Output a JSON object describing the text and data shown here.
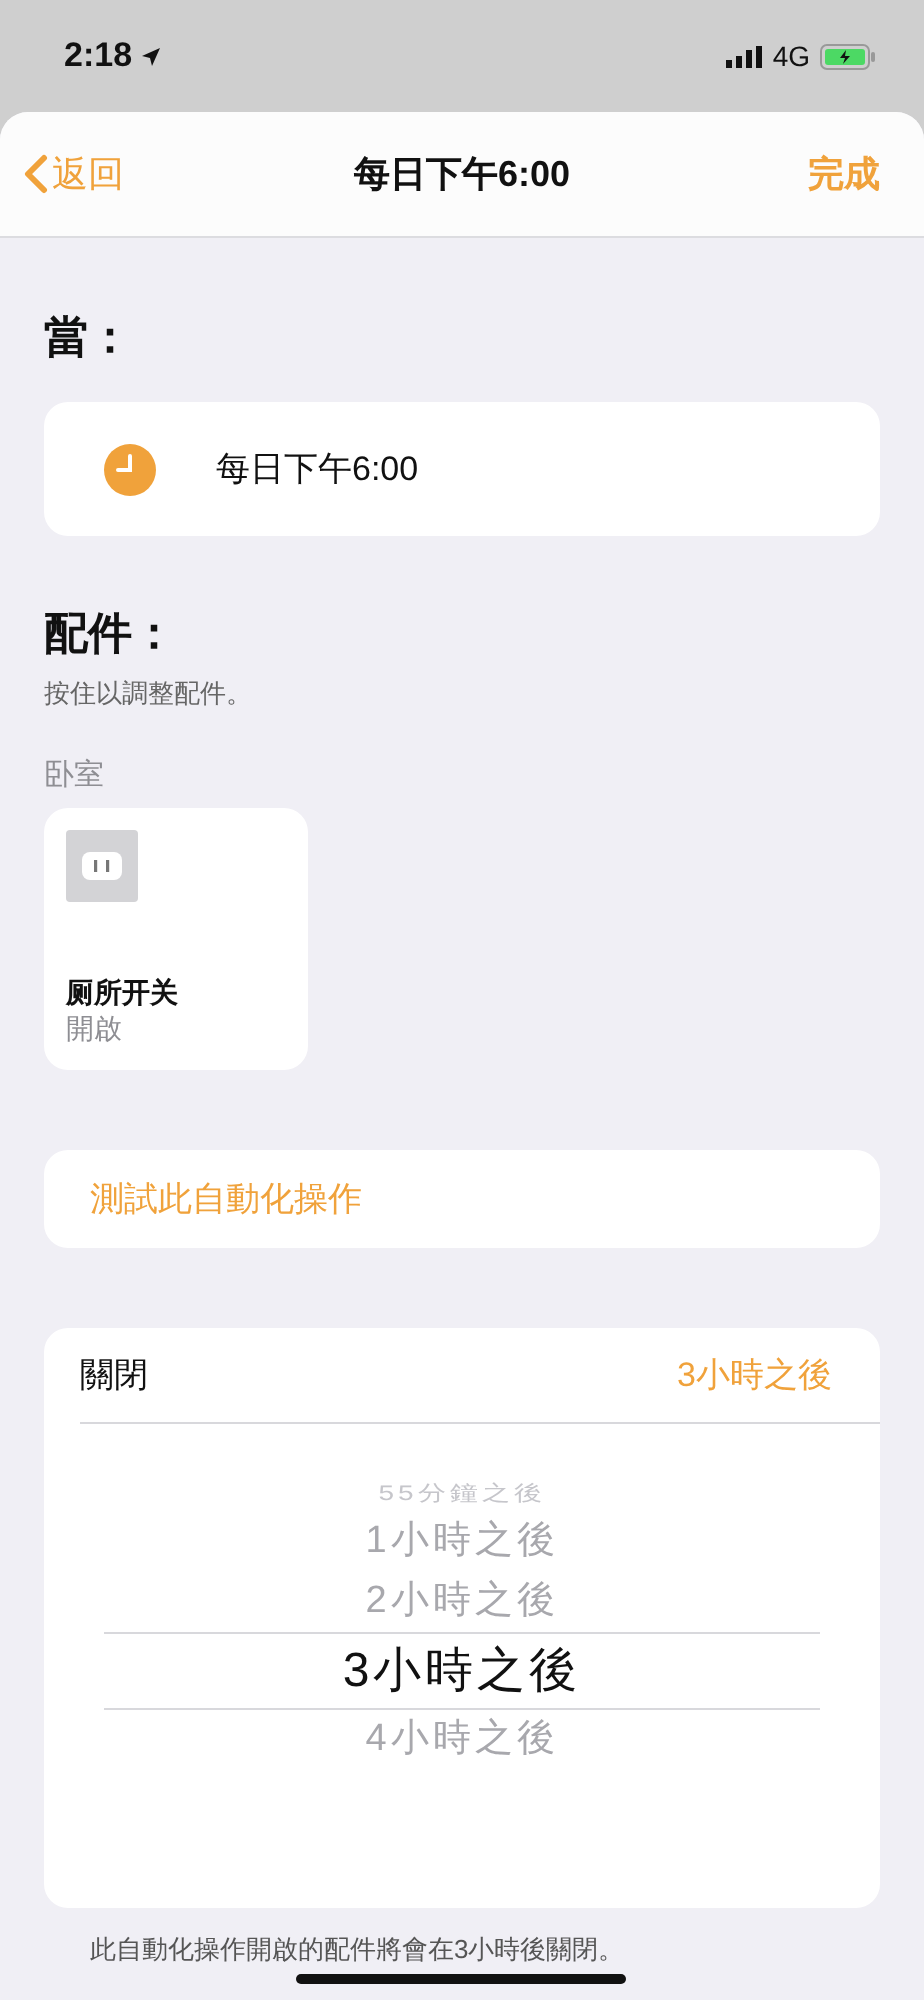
{
  "status_bar": {
    "time": "2:18",
    "network": "4G",
    "charging": true
  },
  "nav": {
    "back": "返回",
    "title": "每日下午6:00",
    "done": "完成"
  },
  "trigger": {
    "heading": "當：",
    "label": "每日下午6:00"
  },
  "accessories": {
    "heading": "配件：",
    "hint": "按住以調整配件。",
    "room": "卧室",
    "items": [
      {
        "name": "厕所开关",
        "status": "開啟"
      }
    ]
  },
  "test_button": "測試此自動化操作",
  "turn_off": {
    "label": "關閉",
    "value": "3小時之後",
    "options": [
      {
        "label": "55分鐘之後",
        "selected": false
      },
      {
        "label": "1小時之後",
        "selected": false
      },
      {
        "label": "2小時之後",
        "selected": false
      },
      {
        "label": "3小時之後",
        "selected": true
      },
      {
        "label": "4小時之後",
        "selected": false
      }
    ],
    "footer": "此自動化操作開啟的配件將會在3小時後關閉。"
  }
}
